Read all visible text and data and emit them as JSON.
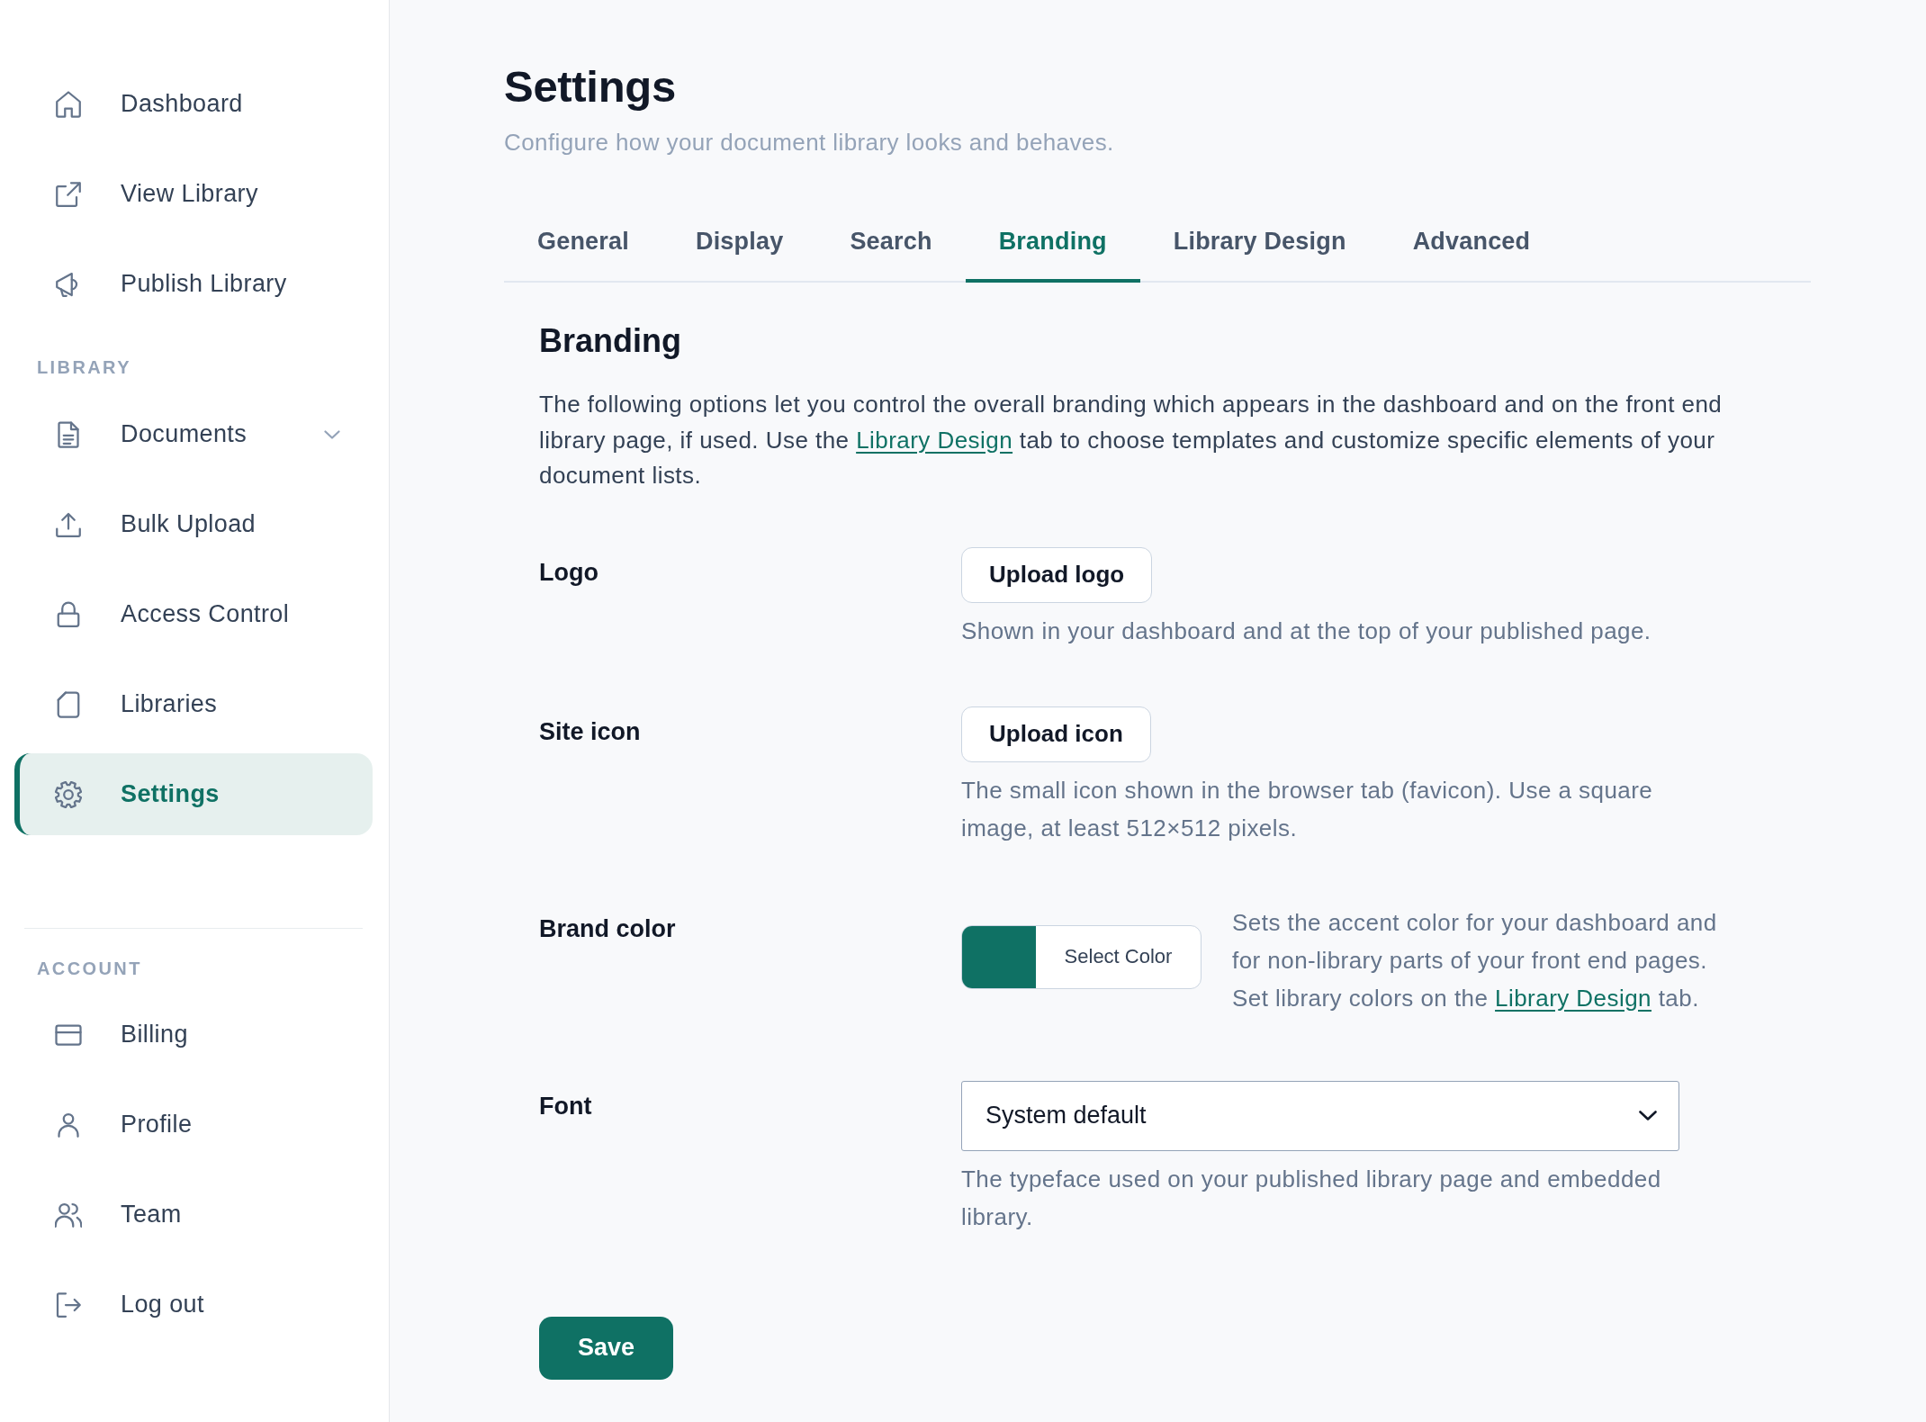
{
  "sidebar": {
    "sections": [
      {
        "items": [
          {
            "label": "Dashboard",
            "selected": false
          },
          {
            "label": "View Library",
            "selected": false
          },
          {
            "label": "Publish Library",
            "selected": false
          }
        ]
      },
      {
        "heading": "LIBRARY",
        "items": [
          {
            "label": "Documents",
            "selected": false,
            "expanded": false
          },
          {
            "label": "Bulk Upload",
            "selected": false
          },
          {
            "label": "Access Control",
            "selected": false
          },
          {
            "label": "Libraries",
            "selected": false
          },
          {
            "label": "Settings",
            "selected": true
          }
        ]
      }
    ],
    "account": {
      "heading": "ACCOUNT",
      "items": [
        {
          "label": "Billing",
          "selected": false
        },
        {
          "label": "Profile",
          "selected": false
        },
        {
          "label": "Team",
          "selected": false
        },
        {
          "label": "Log out",
          "selected": false
        }
      ]
    }
  },
  "page": {
    "title": "Settings",
    "subtitle": "Configure how your document library looks and behaves."
  },
  "tabs": [
    {
      "label": "General",
      "selected": false
    },
    {
      "label": "Display",
      "selected": false
    },
    {
      "label": "Search",
      "selected": false
    },
    {
      "label": "Branding",
      "selected": true
    },
    {
      "label": "Library Design",
      "selected": false
    },
    {
      "label": "Advanced",
      "selected": false
    }
  ],
  "panel": {
    "heading": "Branding",
    "intro": {
      "before": "The following options let you control the overall branding which appears in the dashboard and on the front end library page, if used. Use the ",
      "link": "Library Design",
      "after": " tab to choose templates and customize specific elements of your document lists."
    }
  },
  "settings": [
    {
      "label": "Logo",
      "kind": "upload",
      "button": "Upload logo",
      "help": "Shown in your dashboard and at the top of your published page."
    },
    {
      "label": "Site icon",
      "kind": "upload",
      "button": "Upload icon",
      "help": "The small icon shown in the browser tab (favicon). Use a square image, at least 512×512 pixels."
    },
    {
      "label": "Brand color",
      "kind": "color",
      "color": "#0f7164",
      "button": "Select Color",
      "help": {
        "before": "Sets the accent color for your dashboard and for non-library parts of your front end pages. Set library colors on the ",
        "link": "Library Design",
        "after": " tab."
      }
    },
    {
      "label": "Font",
      "kind": "select",
      "value": "System default",
      "help": "The typeface used on your published library page and embedded library."
    }
  ],
  "save_button": "Save"
}
